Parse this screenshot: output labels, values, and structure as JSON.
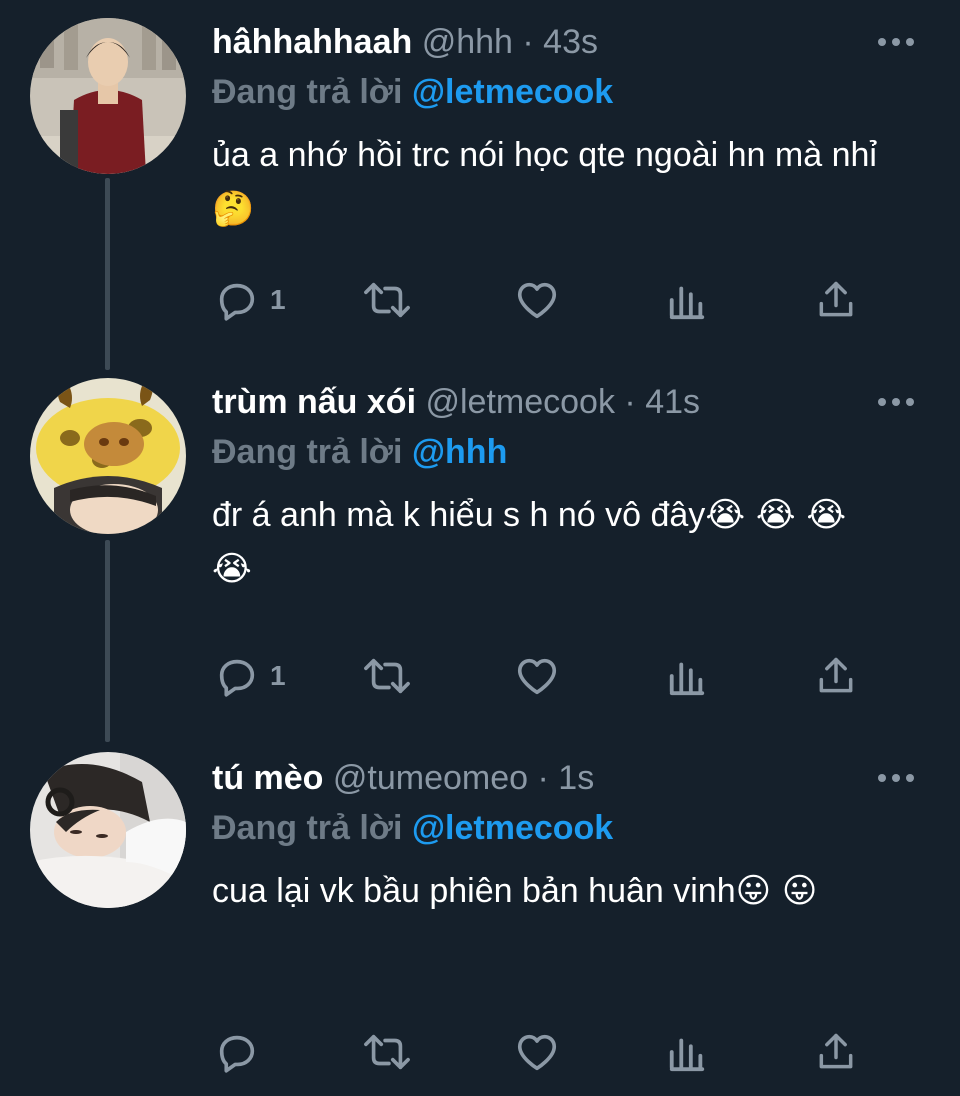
{
  "tweets": [
    {
      "name": "hâhhahhaah",
      "handle": "@hhh",
      "time": "· 43s",
      "replying_label": "Đang trả lời",
      "replying_to": "@letmecook",
      "text": "ủa a nhớ hồi trc nói học qte ngoài hn mà nhỉ",
      "emoji": "🤔",
      "reply_count": "1"
    },
    {
      "name": "trùm nấu xói",
      "handle": "@letmecook",
      "time": "· 41s",
      "replying_label": "Đang trả lời",
      "replying_to": "@hhh",
      "text": "đr á anh mà k hiểu s h nó vô đây",
      "emoji": "😭 😭 😭 😭",
      "reply_count": "1"
    },
    {
      "name": "tú mèo",
      "handle": "@tumeomeo",
      "time": "· 1s",
      "replying_label": "Đang trả lời",
      "replying_to": "@letmecook",
      "text": "cua lại vk bầu phiên bản huân vinh",
      "emoji": "😛 😛",
      "reply_count": ""
    }
  ],
  "colors": {
    "background": "#15202b",
    "name": "#ffffff",
    "meta": "#8b98a5",
    "link": "#1d9bf0",
    "thread_line": "#3d4a55"
  },
  "icons": [
    "reply-icon",
    "retweet-icon",
    "like-icon",
    "analytics-icon",
    "share-icon",
    "more-icon"
  ]
}
